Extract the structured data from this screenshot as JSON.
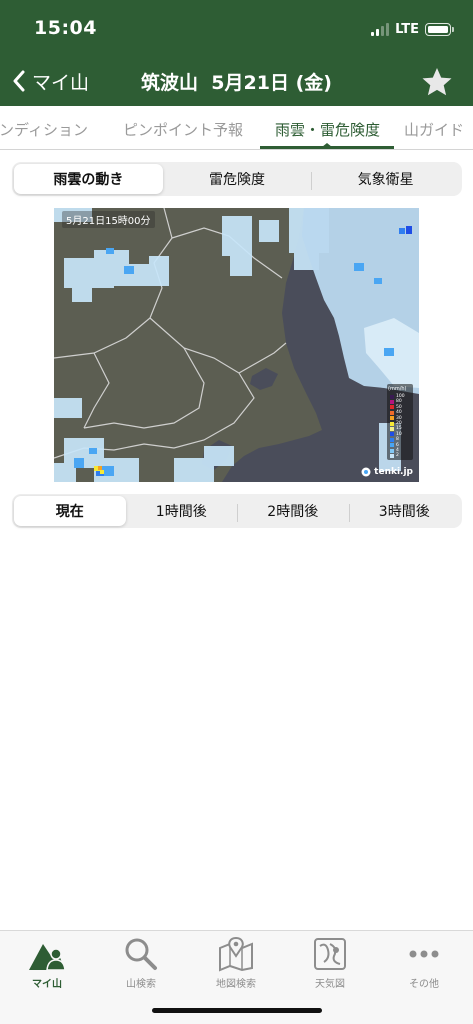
{
  "status_bar": {
    "time": "15:04",
    "network": "LTE"
  },
  "header": {
    "back_label": "マイ山",
    "title": "筑波山",
    "date": "5月21日 (金)"
  },
  "tabs": [
    {
      "label": "コンディション",
      "active": false
    },
    {
      "label": "ピンポイント予報",
      "active": false
    },
    {
      "label": "雨雲・雷危険度",
      "active": true
    },
    {
      "label": "山ガイド",
      "active": false
    }
  ],
  "map_mode": {
    "options": [
      "雨雲の動き",
      "雷危険度",
      "気象衛星"
    ],
    "selected": "雨雲の動き"
  },
  "radar": {
    "timestamp": "5月21日15時00分",
    "legend_unit": "(mm/h)",
    "legend": [
      {
        "value": "100",
        "color": "#3a1b52"
      },
      {
        "value": "80",
        "color": "#b4147e"
      },
      {
        "value": "50",
        "color": "#e0282b"
      },
      {
        "value": "40",
        "color": "#f06a2a"
      },
      {
        "value": "30",
        "color": "#f6a221"
      },
      {
        "value": "20",
        "color": "#f7e935"
      },
      {
        "value": "15",
        "color": "#f2f08a"
      },
      {
        "value": "10",
        "color": "#1f4de6"
      },
      {
        "value": "8",
        "color": "#2f7ef0"
      },
      {
        "value": "6",
        "color": "#4aa6f3"
      },
      {
        "value": "4",
        "color": "#82c8f5"
      },
      {
        "value": "2",
        "color": "#c8e6fa"
      }
    ],
    "credit": "tenki.jp"
  },
  "time_offset": {
    "options": [
      "現在",
      "1時間後",
      "2時間後",
      "3時間後"
    ],
    "selected": "現在"
  },
  "bottom_nav": [
    {
      "label": "マイ山",
      "icon": "mountain-person-icon",
      "active": true
    },
    {
      "label": "山検索",
      "icon": "search-icon",
      "active": false
    },
    {
      "label": "地図検索",
      "icon": "map-pin-icon",
      "active": false
    },
    {
      "label": "天気図",
      "icon": "weather-chart-icon",
      "active": false
    },
    {
      "label": "その他",
      "icon": "more-icon",
      "active": false
    }
  ],
  "colors": {
    "brand_green": "#2e5d34",
    "land": "#5c5e52",
    "sea": "#4a4d5a",
    "rain_light": "#c8e6fa"
  }
}
